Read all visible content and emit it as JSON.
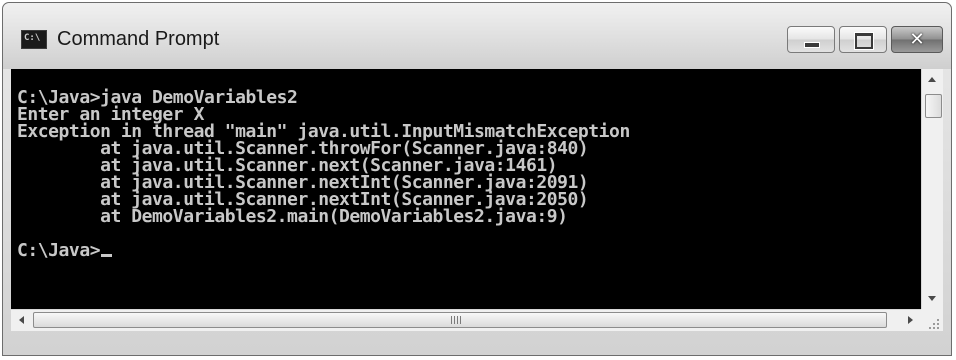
{
  "window": {
    "title": "Command Prompt",
    "app_icon_text": "C:\\",
    "icon": "console-icon",
    "controls": {
      "minimize_icon": "minimize-icon",
      "maximize_icon": "maximize-icon",
      "close_icon": "close-icon",
      "close_glyph": "✕"
    }
  },
  "console": {
    "text": "C:\\Java>java DemoVariables2\nEnter an integer X\nException in thread \"main\" java.util.InputMismatchException\n        at java.util.Scanner.throwFor(Scanner.java:840)\n        at java.util.Scanner.next(Scanner.java:1461)\n        at java.util.Scanner.nextInt(Scanner.java:2091)\n        at java.util.Scanner.nextInt(Scanner.java:2050)\n        at DemoVariables2.main(DemoVariables2.java:9)\n\nC:\\Java>"
  },
  "colors": {
    "console_background": "#000000",
    "console_text": "#c8c8c8"
  }
}
